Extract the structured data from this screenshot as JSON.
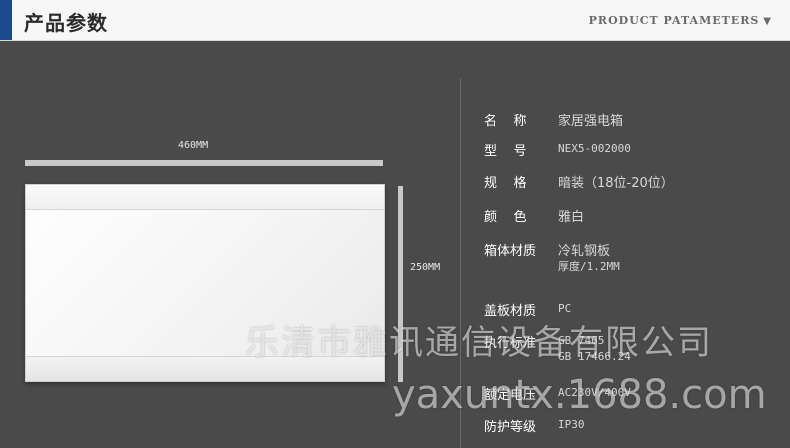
{
  "header": {
    "title": "产品参数",
    "subtitle": "PRODUCT PATAMETERS",
    "arrow": "▼"
  },
  "product": {
    "width_label": "460MM",
    "height_label": "250MM"
  },
  "specs": [
    {
      "label": "名    称",
      "value": "家居强电箱"
    },
    {
      "label": "型    号",
      "value": "NEX5-002000"
    },
    {
      "label": "规    格",
      "value": "暗装（18位-20位）"
    },
    {
      "label": "颜    色",
      "value": "雅白"
    },
    {
      "label": "箱体材质",
      "value": "冷轧钢板",
      "value2": "厚度/1.2MM"
    },
    {
      "label": "盖板材质",
      "value": "PC"
    },
    {
      "label": "执行标准",
      "value": "GB 7465",
      "value2": "GB 17466.24"
    },
    {
      "label": "额定电压",
      "value": "AC230V/400V"
    },
    {
      "label": "防护等级",
      "value": "IP30"
    }
  ],
  "watermark": {
    "line1": "乐清市雅讯通信设备有限公司",
    "line2": "yaxuntx.1688.com"
  }
}
